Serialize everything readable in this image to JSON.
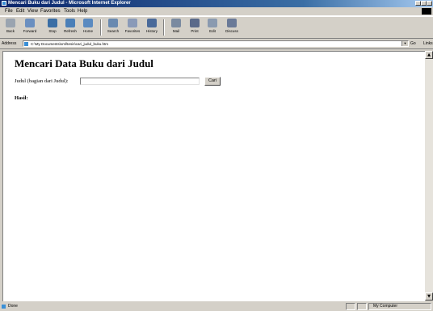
{
  "window": {
    "title": "Mencari Buku dari Judul - Microsoft Internet Explorer"
  },
  "menu": [
    "File",
    "Edit",
    "View",
    "Favorites",
    "Tools",
    "Help"
  ],
  "toolbar": {
    "buttons": [
      {
        "label": "Back",
        "icon": "back-arrow-icon"
      },
      {
        "label": "Forward",
        "icon": "forward-arrow-icon"
      },
      {
        "label": "Stop",
        "icon": "stop-icon"
      },
      {
        "label": "Refresh",
        "icon": "refresh-icon"
      },
      {
        "label": "Home",
        "icon": "home-icon"
      },
      {
        "label": "Search",
        "icon": "search-icon"
      },
      {
        "label": "Favorites",
        "icon": "favorites-icon"
      },
      {
        "label": "History",
        "icon": "history-icon"
      },
      {
        "label": "Mail",
        "icon": "mail-icon"
      },
      {
        "label": "Print",
        "icon": "print-icon"
      },
      {
        "label": "Edit",
        "icon": "edit-icon"
      },
      {
        "label": "Discuss",
        "icon": "discuss-icon"
      }
    ]
  },
  "address": {
    "label": "Address",
    "value": "C:\\My Documents\\xml\\tesis\\cari_judul_buku.htm",
    "go_label": "Go",
    "links_label": "Links"
  },
  "page": {
    "heading": "Mencari Data Buku dari Judul",
    "form_label": "Judul (bagian dari Judul):",
    "input_value": "",
    "button_label": "Cari",
    "result_label": "Hasil:"
  },
  "status": {
    "text": "Done",
    "zone": "My Computer"
  },
  "colors": {
    "titlebar_start": "#0a246a",
    "chrome": "#d4d0c8",
    "content_bg": "#ffffff"
  }
}
